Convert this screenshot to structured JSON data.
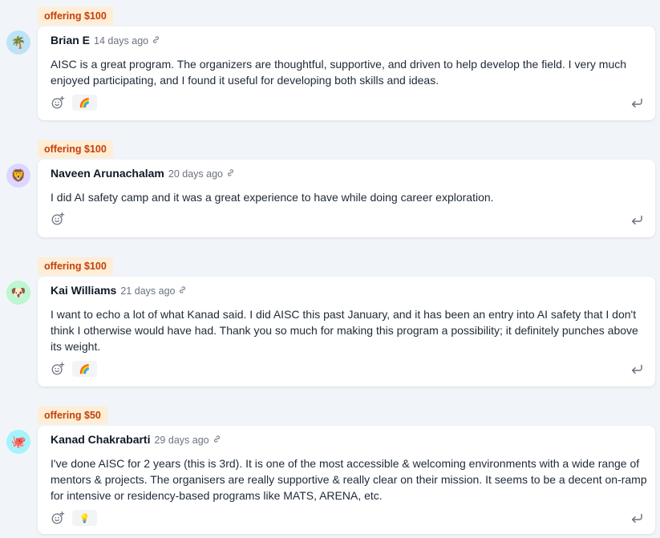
{
  "comments": [
    {
      "offer": "offering $100",
      "avatar": "🌴",
      "avatar_bg": "#bde3f7",
      "author": "Brian E",
      "time": "14 days ago",
      "text": "AISC is a great program. The organizers are thoughtful, supportive, and driven to help develop the field. I very much enjoyed participating, and I found it useful for developing both skills and ideas.",
      "reaction": "🌈"
    },
    {
      "offer": "offering $100",
      "avatar": "🦁",
      "avatar_bg": "#ddd6fe",
      "author": "Naveen Arunachalam",
      "time": "20 days ago",
      "text": "I did AI safety camp and it was a great experience to have while doing career exploration.",
      "reaction": ""
    },
    {
      "offer": "offering $100",
      "avatar": "🐶",
      "avatar_bg": "#bbf7d0",
      "author": "Kai Williams",
      "time": "21 days ago",
      "text": "I want to echo a lot of what Kanad said. I did AISC this past January, and it has been an entry into AI safety that I don't think I otherwise would have had. Thank you so much for making this program a possibility; it definitely punches above its weight.",
      "reaction": "🌈"
    },
    {
      "offer": "offering $50",
      "avatar": "🐙",
      "avatar_bg": "#a5f3fc",
      "author": "Kanad Chakrabarti",
      "time": "29 days ago",
      "text": "I've done AISC for 2 years (this is 3rd). It is one of the most accessible & welcoming environments with a wide range of mentors & projects. The organisers are really supportive & really clear on their mission. It seems to be a decent on-ramp for intensive or residency-based programs like MATS, ARENA, etc.",
      "reaction": "💡"
    }
  ],
  "colors": {
    "badge_bg": "#ffedd5",
    "badge_text": "#c2410c",
    "page_bg": "#f1f5f9",
    "card_bg": "#ffffff"
  },
  "icons": {
    "link": "link-icon",
    "add_reaction": "add-reaction-icon",
    "reply": "reply-icon"
  }
}
